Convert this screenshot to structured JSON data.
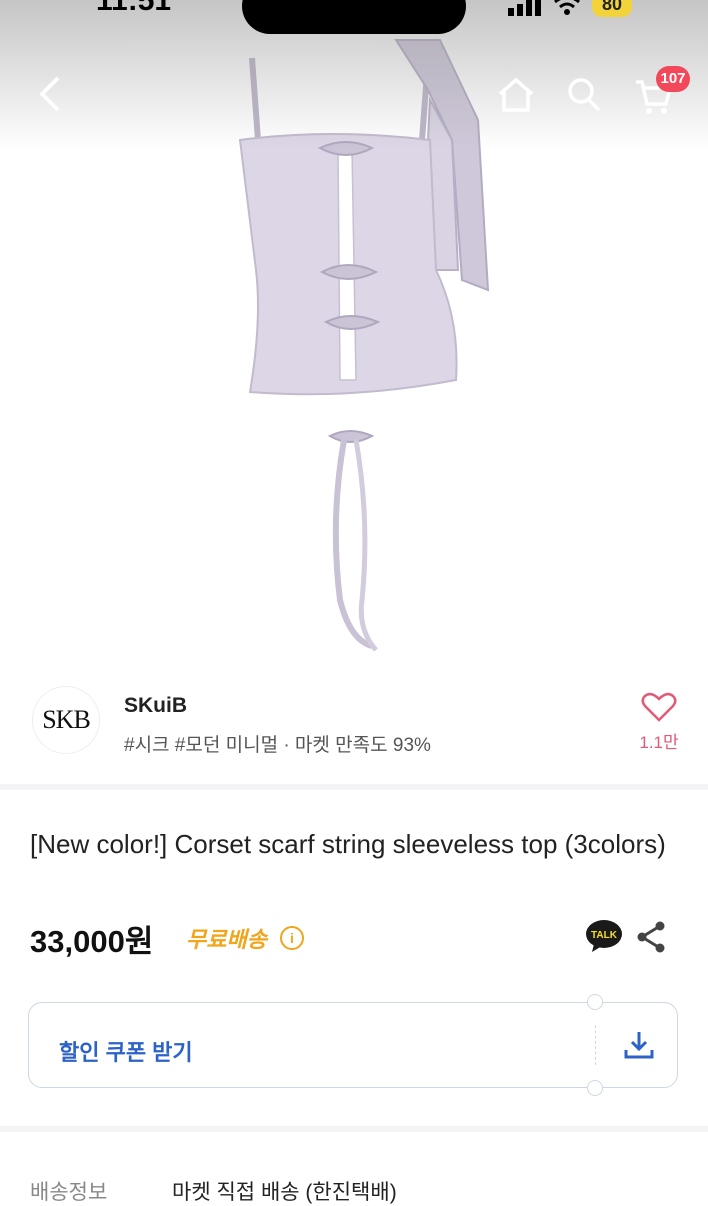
{
  "status_bar": {
    "time": "11:51",
    "battery": "80"
  },
  "nav": {
    "cart_count": "107"
  },
  "store": {
    "logo_text": "SKB",
    "name": "SKuiB",
    "tags": "#시크 #모던 미니멀 · 마켓 만족도 93%",
    "likes": "1.1만"
  },
  "product": {
    "title": "[New color!] Corset scarf string sleeveless top (3colors)",
    "price": "33,000원",
    "free_shipping": "무료배송",
    "talk_label": "TALK"
  },
  "coupon": {
    "label": "할인 쿠폰 받기"
  },
  "shipping": {
    "label": "배송정보",
    "value": "마켓 직접 배송 (한진택배)"
  },
  "colors": {
    "garment": "#d9d3e3",
    "accent_orange": "#f0a51a",
    "coupon_blue": "#2d63c8",
    "badge_red": "#f2485a"
  }
}
